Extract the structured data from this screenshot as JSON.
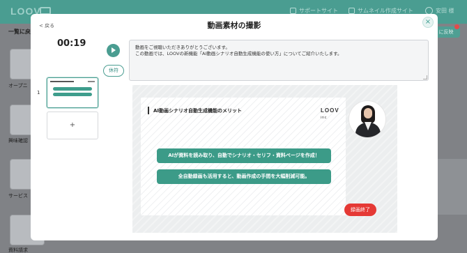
{
  "app": {
    "logo": "LOOV",
    "nav": {
      "support": "サポートサイト",
      "thumbnail": "サムネイル作成サイト",
      "user": "安田 様"
    }
  },
  "background": {
    "left_title": "一覧に戻",
    "sections": [
      "オープニ",
      "興味確認",
      "サービス",
      "資料請求"
    ],
    "right_button": "に反映"
  },
  "modal": {
    "title": "動画素材の撮影",
    "back_label": "< 戻る",
    "close_icon": "×",
    "timer": "00:19",
    "pause_label": "休符",
    "script_lines": [
      "動画をご視聴いただきありがとうございます。",
      "この動画では、LOOVの新機能「AI動画シナリオ自動生成機能の使い方」についてご紹介いたします。"
    ],
    "slide_number": "1",
    "add_slide_label": "+",
    "record_end_label": "録画終了"
  },
  "slide": {
    "title": "AI動画シナリオ自動生成機能のメリット",
    "logo": "LOOV",
    "logo_suffix": "inc",
    "points": [
      "AIが資料を読み取り、自動でシナリオ・セリフ・資料ページを作成！",
      "全自動録画も活用すると、動画作成の手間を大幅削減可能。"
    ]
  },
  "colors": {
    "accent": "#4a9d91",
    "slide_pill": "#3c9b88",
    "record": "#e53935"
  }
}
